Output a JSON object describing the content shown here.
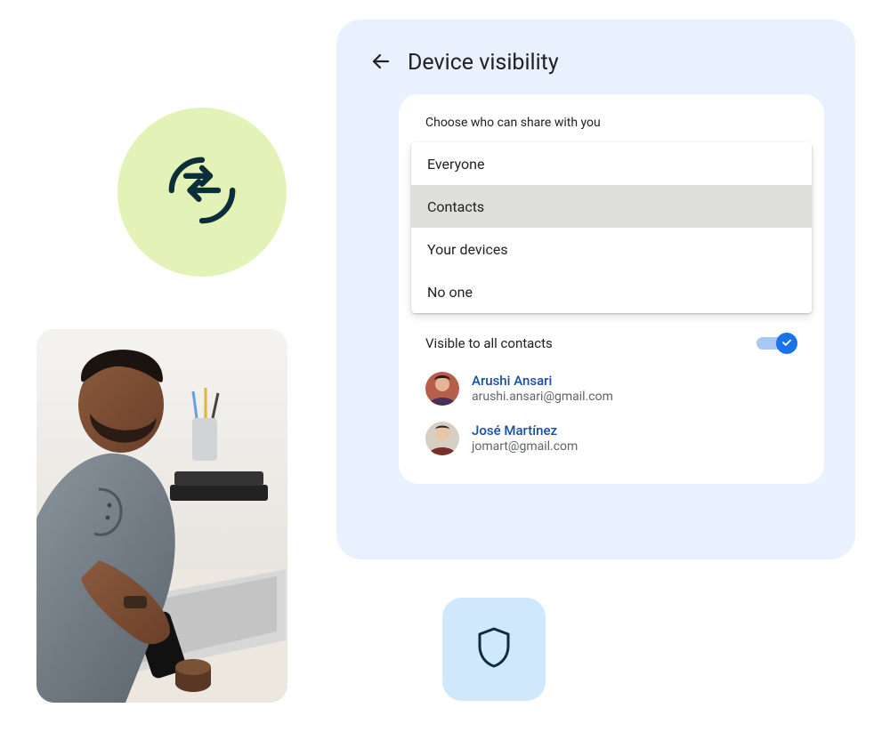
{
  "panel": {
    "title": "Device visibility",
    "section_label": "Choose who can share with you",
    "options": [
      "Everyone",
      "Contacts",
      "Your devices",
      "No one"
    ],
    "selected_index": 1,
    "visibility_row_label": "Visible to all contacts",
    "visibility_toggle_on": true,
    "contacts": [
      {
        "name": "Arushi Ansari",
        "email": "arushi.ansari@gmail.com"
      },
      {
        "name": "José Martínez",
        "email": "jomart@gmail.com"
      }
    ]
  },
  "decor": {
    "sync_icon": "sync-icon",
    "shield_icon": "shield-icon",
    "photo_alt": "Person using a phone at a desk with laptops"
  },
  "colors": {
    "panel_bg": "#e9f0fe",
    "green_circle": "#e3f2b6",
    "shield_tile": "#cfe8fb",
    "accent": "#1a73e8",
    "link": "#174ea6"
  }
}
